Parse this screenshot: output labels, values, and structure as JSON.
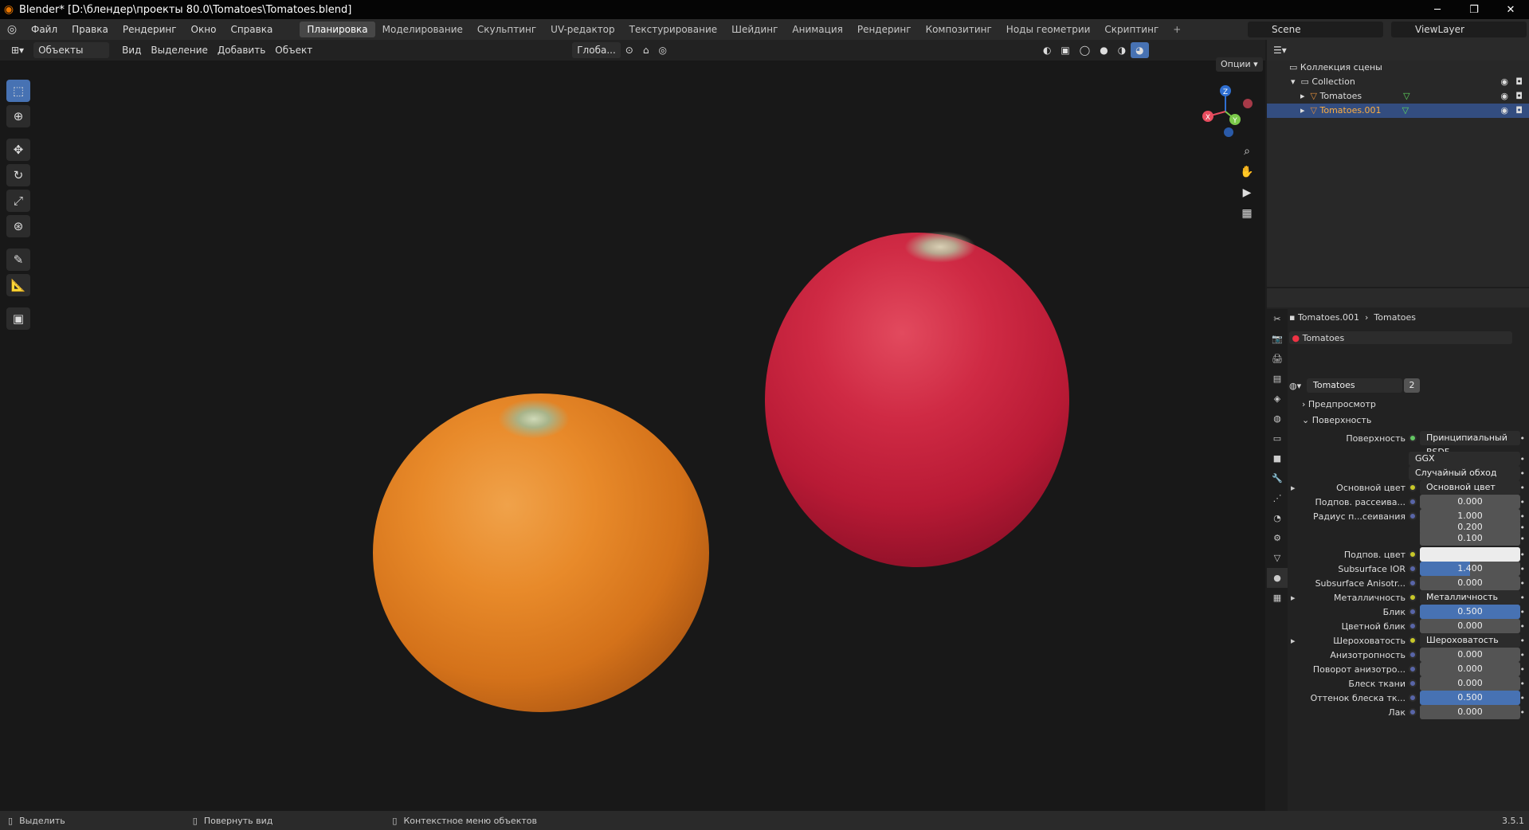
{
  "window": {
    "title": "Blender* [D:\\блендер\\проекты 80.0\\Tomatoes\\Tomatoes.blend]",
    "min": "─",
    "max": "❐",
    "close": "✕"
  },
  "menu": [
    "Файл",
    "Правка",
    "Рендеринг",
    "Окно",
    "Справка"
  ],
  "workspaces": [
    "Планировка",
    "Моделирование",
    "Скульптинг",
    "UV-редактор",
    "Текстурирование",
    "Шейдинг",
    "Анимация",
    "Рендеринг",
    "Композитинг",
    "Ноды геометрии",
    "Скриптинг",
    "+"
  ],
  "active_workspace": "Планировка",
  "scene": "Scene",
  "view_layer": "ViewLayer",
  "viewport_header": {
    "mode": "Объекты",
    "items": [
      "Вид",
      "Выделение",
      "Добавить",
      "Объект"
    ],
    "transform": "Глоба...",
    "options": "Опции"
  },
  "outliner": {
    "root": "Коллекция сцены",
    "rows": [
      {
        "label": "Collection",
        "selected": false
      },
      {
        "label": "Tomatoes",
        "selected": false
      },
      {
        "label": "Tomatoes.001",
        "selected": true
      }
    ]
  },
  "properties": {
    "breadcrumb_object": "Tomatoes.001",
    "breadcrumb_material": "Tomatoes",
    "slot": "Tomatoes",
    "material_name": "Tomatoes",
    "users": "2",
    "section_preview": "Предпросмотр",
    "section_surface": "Поверхность",
    "rows": [
      {
        "label": "Поверхность",
        "value": "Принципиальный BSDF",
        "kind": "shader"
      },
      {
        "label": "",
        "value": "GGX",
        "kind": "dropdown"
      },
      {
        "label": "",
        "value": "Случайный обход",
        "kind": "dropdown"
      },
      {
        "label": "Основной цвет",
        "value": "Основной цвет",
        "kind": "link"
      },
      {
        "label": "Подпов. рассеива...",
        "value": "0.000",
        "kind": "num"
      },
      {
        "label": "Радиус п...сеивания",
        "value": "1.000",
        "kind": "num"
      },
      {
        "label": "",
        "value": "0.200",
        "kind": "num"
      },
      {
        "label": "",
        "value": "0.100",
        "kind": "num"
      },
      {
        "label": "Подпов. цвет",
        "value": "",
        "kind": "color"
      },
      {
        "label": "Subsurface IOR",
        "value": "1.400",
        "kind": "slider"
      },
      {
        "label": "Subsurface Anisotr...",
        "value": "0.000",
        "kind": "num"
      },
      {
        "label": "Металличность",
        "value": "Металличность",
        "kind": "link"
      },
      {
        "label": "Блик",
        "value": "0.500",
        "kind": "full"
      },
      {
        "label": "Цветной блик",
        "value": "0.000",
        "kind": "num"
      },
      {
        "label": "Шероховатость",
        "value": "Шероховатость",
        "kind": "link"
      },
      {
        "label": "Анизотропность",
        "value": "0.000",
        "kind": "num"
      },
      {
        "label": "Поворот анизотро...",
        "value": "0.000",
        "kind": "num"
      },
      {
        "label": "Блеск ткани",
        "value": "0.000",
        "kind": "num"
      },
      {
        "label": "Оттенок блеска тк...",
        "value": "0.500",
        "kind": "full"
      },
      {
        "label": "Лак",
        "value": "0.000",
        "kind": "num"
      }
    ]
  },
  "statusbar": {
    "select": "Выделить",
    "rotate": "Повернуть вид",
    "context": "Контекстное меню объектов",
    "version": "3.5.1"
  },
  "gizmo": {
    "x": "X",
    "y": "Y",
    "z": "Z"
  }
}
